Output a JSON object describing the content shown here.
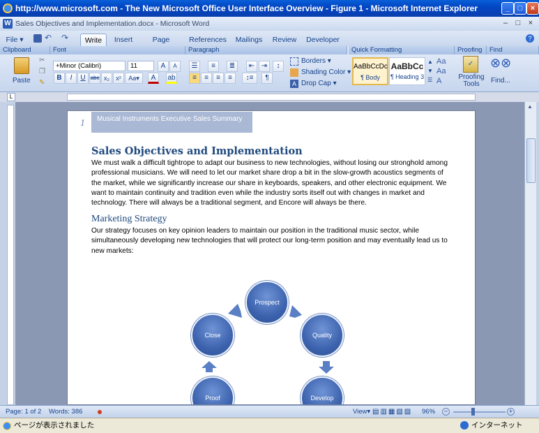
{
  "ie": {
    "title": "http://www.microsoft.com - The New Microsoft Office User Interface Overview - Figure 1 - Microsoft Internet Explorer",
    "status": "ページが表示されました",
    "zone": "インターネット"
  },
  "word": {
    "doc_title": "Sales Objectives and Implementation.docx - Microsoft Word",
    "file_menu": "File",
    "tabs": [
      "Write",
      "Insert",
      "Page Layout",
      "References",
      "Mailings",
      "Review",
      "Developer"
    ],
    "groups": [
      "Clipboard",
      "Font",
      "Paragraph",
      "Quick Formatting",
      "Proofing",
      "Find"
    ],
    "paste_label": "Paste",
    "font_name": "+Minor (Calibri)",
    "font_size": "11",
    "borders_label": "Borders",
    "shading_label": "Shading Color",
    "dropcap_label": "Drop Cap",
    "styles": [
      {
        "preview": "AaBbCcDc",
        "name": "¶ Body"
      },
      {
        "preview": "AaBbCc",
        "name": "¶ Heading 3"
      }
    ],
    "proofing_label": "Proofing Tools",
    "find_label": "Find..."
  },
  "document": {
    "header_number": "1",
    "header_text": "Musical Instruments Executive Sales Summary",
    "heading1": "Sales Objectives and Implementation",
    "para1": "We must walk a difficult tightrope to adapt our business to new technologies, without losing our stronghold among professional musicians. We will need to let our market share drop a bit in the slow-growth acoustics segments of the market, while we significantly increase our share in keyboards, speakers, and other electronic equipment. We want to maintain continuity and tradition even while the industry sorts itself out with changes in market and technology. There will always be a traditional segment, and Encore will always be there.",
    "heading2": "Marketing Strategy",
    "para2": "Our strategy focuses on key opinion leaders to maintain our position in the traditional music sector, while simultaneously developing new technologies that will protect our long-term position and may eventually lead us to new markets:",
    "diagram": [
      "Prospect",
      "Quality",
      "Develop",
      "Proof",
      "Close"
    ]
  },
  "status": {
    "page": "Page: 1 of 2",
    "words": "Words: 386",
    "view": "View",
    "zoom": "96%"
  }
}
